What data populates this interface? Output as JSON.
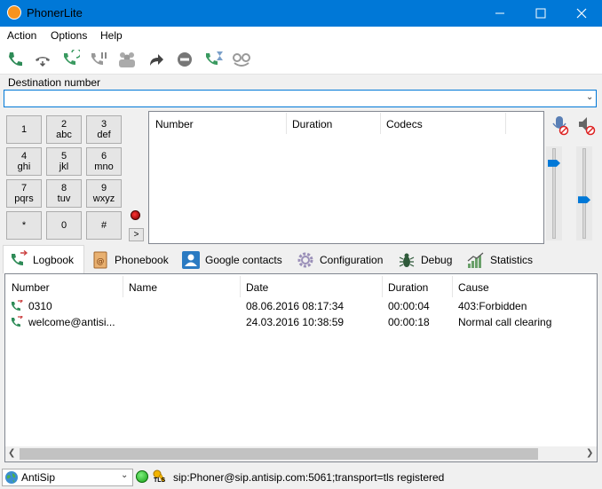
{
  "window": {
    "title": "PhonerLite"
  },
  "colors": {
    "titlebar": "#0078d7",
    "accent_green": "#2e8b57",
    "status_ok": "#22c022"
  },
  "menu": {
    "items": [
      "Action",
      "Options",
      "Help"
    ]
  },
  "toolbar": {
    "buttons": [
      "call-icon",
      "hangup-icon",
      "redial-icon",
      "hold-icon",
      "conference-icon",
      "transfer-icon",
      "reject-icon",
      "callback-timer-icon",
      "mute-microphone-icon"
    ]
  },
  "destination": {
    "label": "Destination number",
    "value": ""
  },
  "keypad": {
    "keys": [
      {
        "digit": "1",
        "letters": ""
      },
      {
        "digit": "2",
        "letters": "abc"
      },
      {
        "digit": "3",
        "letters": "def"
      },
      {
        "digit": "4",
        "letters": "ghi"
      },
      {
        "digit": "5",
        "letters": "jkl"
      },
      {
        "digit": "6",
        "letters": "mno"
      },
      {
        "digit": "7",
        "letters": "pqrs"
      },
      {
        "digit": "8",
        "letters": "tuv"
      },
      {
        "digit": "9",
        "letters": "wxyz"
      },
      {
        "digit": "*",
        "letters": ""
      },
      {
        "digit": "0",
        "letters": ""
      },
      {
        "digit": "#",
        "letters": ""
      }
    ],
    "expand_label": ">"
  },
  "calls": {
    "columns": [
      "Number",
      "Duration",
      "Codecs"
    ]
  },
  "volume": {
    "microphone_level": 0.82,
    "speaker_level": 0.38
  },
  "tabs": [
    {
      "label": "Logbook",
      "icon": "logbook-icon",
      "active": true
    },
    {
      "label": "Phonebook",
      "icon": "phonebook-icon",
      "active": false
    },
    {
      "label": "Google contacts",
      "icon": "google-contacts-icon",
      "active": false
    },
    {
      "label": "Configuration",
      "icon": "gear-icon",
      "active": false
    },
    {
      "label": "Debug",
      "icon": "bug-icon",
      "active": false
    },
    {
      "label": "Statistics",
      "icon": "chart-icon",
      "active": false
    }
  ],
  "log": {
    "columns": [
      "Number",
      "Name",
      "Date",
      "Duration",
      "Cause"
    ],
    "rows": [
      {
        "number": "0310",
        "name": "",
        "date": "08.06.2016 08:17:34",
        "duration": "00:00:04",
        "cause": "403:Forbidden"
      },
      {
        "number": "welcome@antisi...",
        "name": "",
        "date": "24.03.2016 10:38:59",
        "duration": "00:00:18",
        "cause": "Normal call clearing"
      }
    ]
  },
  "status": {
    "account": "AntiSip",
    "tls_label": "TLS",
    "text": "sip:Phoner@sip.antisip.com:5061;transport=tls registered"
  }
}
